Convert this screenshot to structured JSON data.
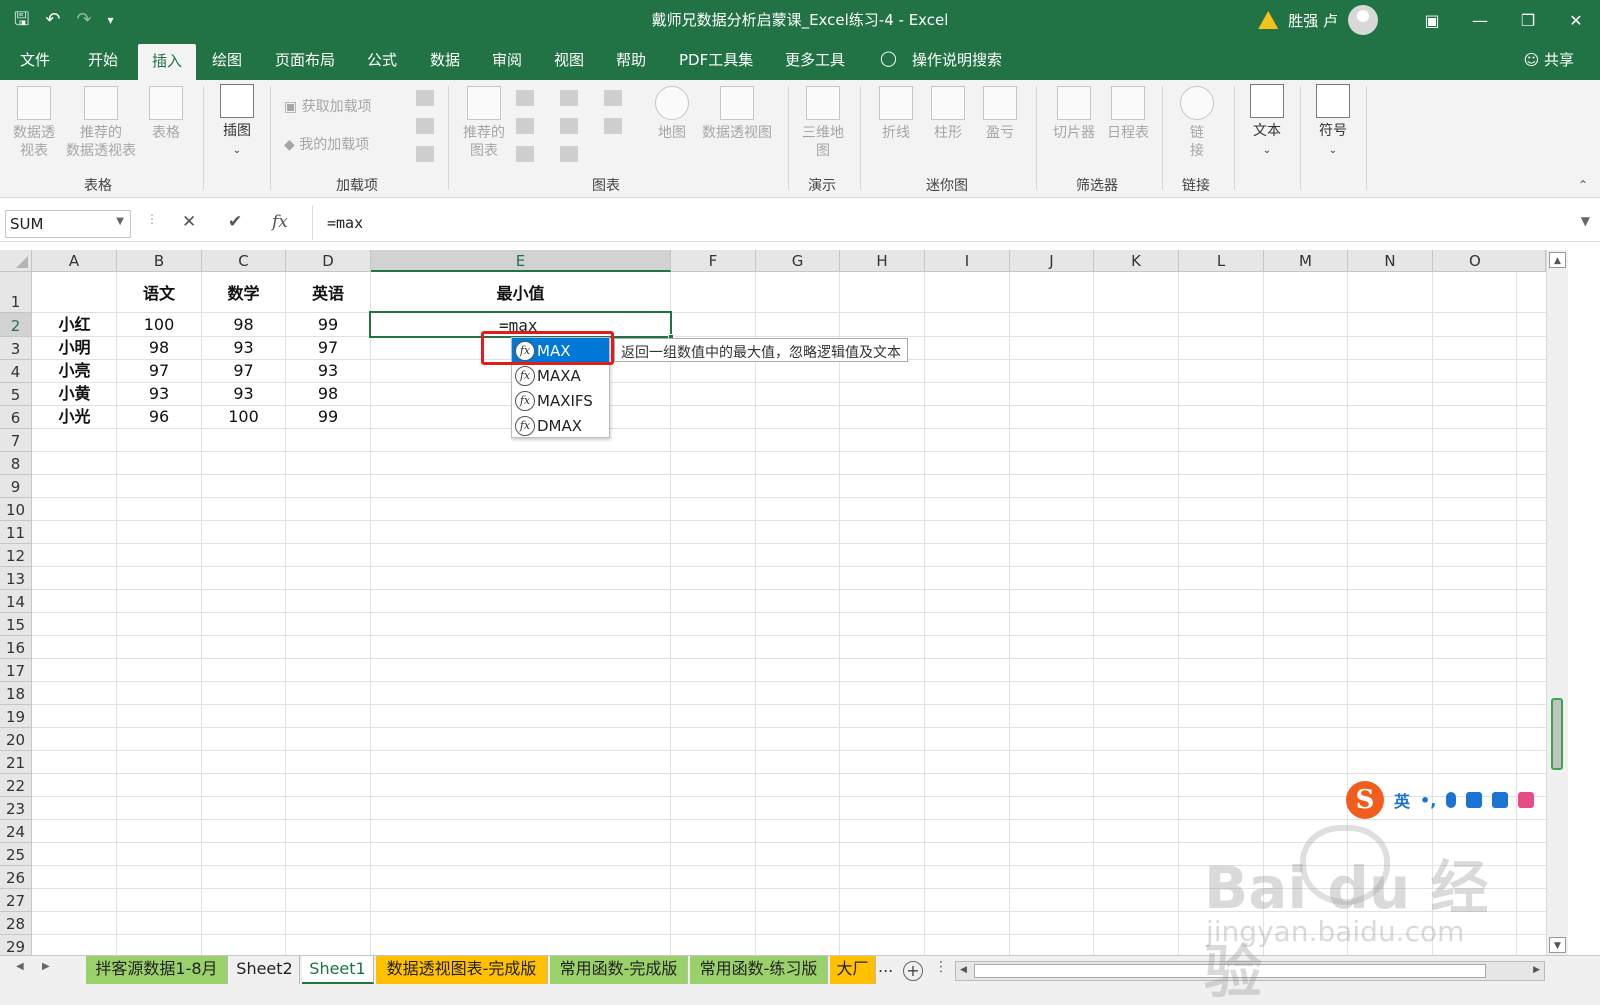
{
  "app": {
    "title": "戴师兄数据分析启蒙课_Excel练习-4  -  Excel",
    "user": "胜强 卢",
    "warning_icon": "warning-icon",
    "colors": {
      "accent": "#217346",
      "highlight": "#e21c1c",
      "selection": "#0078d7"
    }
  },
  "tabs": [
    "文件",
    "开始",
    "插入",
    "绘图",
    "页面布局",
    "公式",
    "数据",
    "审阅",
    "视图",
    "帮助",
    "PDF工具集",
    "更多工具"
  ],
  "tell_me": "操作说明搜索",
  "share": "共享",
  "ribbon": {
    "groups": [
      "表格",
      "加载项",
      "图表",
      "演示",
      "迷你图",
      "筛选器",
      "链接"
    ],
    "buttons": {
      "pivot_table": "数据透\n视表",
      "rec_pivot": "推荐的\n数据透视表",
      "table": "表格",
      "illustrations": "插图",
      "get_addins": "获取加载项",
      "my_addins": "我的加载项",
      "rec_charts": "推荐的\n图表",
      "maps": "地图",
      "pivot_chart": "数据透视图",
      "map3d": "三维地\n图",
      "line": "折线",
      "column": "柱形",
      "winloss": "盈亏",
      "slicer": "切片器",
      "timeline": "日程表",
      "link": "链\n接",
      "text": "文本",
      "symbols": "符号"
    }
  },
  "formula_bar": {
    "name_box": "SUM",
    "formula": "=max",
    "cancel": "✕",
    "enter": "✔",
    "fx": "fx"
  },
  "columns": [
    "A",
    "B",
    "C",
    "D",
    "E",
    "F",
    "G",
    "H",
    "I",
    "J",
    "K",
    "L",
    "M",
    "N",
    "O"
  ],
  "rows": [
    "1",
    "2",
    "3",
    "4",
    "5",
    "6",
    "7",
    "8",
    "9",
    "10",
    "11",
    "12",
    "13",
    "14",
    "15",
    "16",
    "17",
    "18",
    "19",
    "20",
    "21",
    "22",
    "23",
    "24",
    "25",
    "26",
    "27",
    "28",
    "29"
  ],
  "headers": {
    "b": "语文",
    "c": "数学",
    "d": "英语",
    "e": "最小值"
  },
  "data": [
    {
      "name": "小红",
      "b": "100",
      "c": "98",
      "d": "99"
    },
    {
      "name": "小明",
      "b": "98",
      "c": "93",
      "d": "97"
    },
    {
      "name": "小亮",
      "b": "97",
      "c": "97",
      "d": "93"
    },
    {
      "name": "小黄",
      "b": "93",
      "c": "93",
      "d": "98"
    },
    {
      "name": "小光",
      "b": "96",
      "c": "100",
      "d": "99"
    }
  ],
  "editing_value": "=max",
  "autocomplete": {
    "items": [
      "MAX",
      "MAXA",
      "MAXIFS",
      "DMAX"
    ],
    "selected": "MAX",
    "tooltip": "返回一组数值中的最大值，忽略逻辑值及文本"
  },
  "sheets": [
    {
      "label": "拌客源数据1-8月",
      "style": "green"
    },
    {
      "label": "Sheet2",
      "style": "plain"
    },
    {
      "label": "Sheet1",
      "style": "active"
    },
    {
      "label": "数据透视图表-完成版",
      "style": "orange"
    },
    {
      "label": "常用函数-完成版",
      "style": "green"
    },
    {
      "label": "常用函数-练习版",
      "style": "green"
    },
    {
      "label": "大厂",
      "style": "orange"
    }
  ],
  "sheet_more": "...",
  "ime": {
    "lang": "英",
    "punct": "•,"
  },
  "watermark": {
    "logo": "Bai du 经验",
    "url": "jingyan.baidu.com"
  }
}
